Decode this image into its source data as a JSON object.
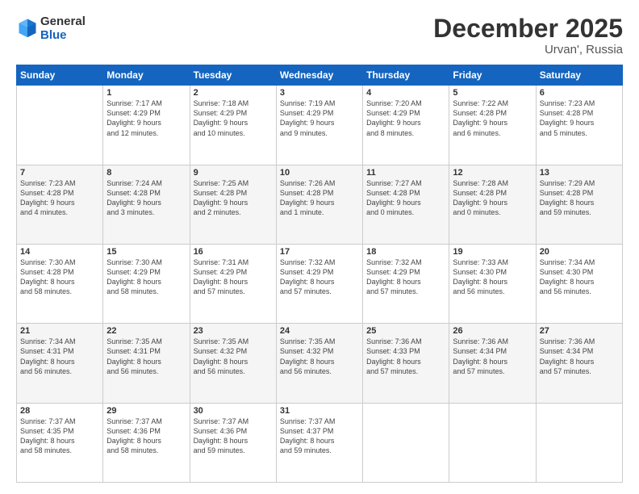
{
  "logo": {
    "line1": "General",
    "line2": "Blue"
  },
  "title": "December 2025",
  "subtitle": "Urvan', Russia",
  "days_of_week": [
    "Sunday",
    "Monday",
    "Tuesday",
    "Wednesday",
    "Thursday",
    "Friday",
    "Saturday"
  ],
  "weeks": [
    [
      {
        "day": "",
        "info": ""
      },
      {
        "day": "1",
        "info": "Sunrise: 7:17 AM\nSunset: 4:29 PM\nDaylight: 9 hours\nand 12 minutes."
      },
      {
        "day": "2",
        "info": "Sunrise: 7:18 AM\nSunset: 4:29 PM\nDaylight: 9 hours\nand 10 minutes."
      },
      {
        "day": "3",
        "info": "Sunrise: 7:19 AM\nSunset: 4:29 PM\nDaylight: 9 hours\nand 9 minutes."
      },
      {
        "day": "4",
        "info": "Sunrise: 7:20 AM\nSunset: 4:29 PM\nDaylight: 9 hours\nand 8 minutes."
      },
      {
        "day": "5",
        "info": "Sunrise: 7:22 AM\nSunset: 4:28 PM\nDaylight: 9 hours\nand 6 minutes."
      },
      {
        "day": "6",
        "info": "Sunrise: 7:23 AM\nSunset: 4:28 PM\nDaylight: 9 hours\nand 5 minutes."
      }
    ],
    [
      {
        "day": "7",
        "info": "Sunrise: 7:23 AM\nSunset: 4:28 PM\nDaylight: 9 hours\nand 4 minutes."
      },
      {
        "day": "8",
        "info": "Sunrise: 7:24 AM\nSunset: 4:28 PM\nDaylight: 9 hours\nand 3 minutes."
      },
      {
        "day": "9",
        "info": "Sunrise: 7:25 AM\nSunset: 4:28 PM\nDaylight: 9 hours\nand 2 minutes."
      },
      {
        "day": "10",
        "info": "Sunrise: 7:26 AM\nSunset: 4:28 PM\nDaylight: 9 hours\nand 1 minute."
      },
      {
        "day": "11",
        "info": "Sunrise: 7:27 AM\nSunset: 4:28 PM\nDaylight: 9 hours\nand 0 minutes."
      },
      {
        "day": "12",
        "info": "Sunrise: 7:28 AM\nSunset: 4:28 PM\nDaylight: 9 hours\nand 0 minutes."
      },
      {
        "day": "13",
        "info": "Sunrise: 7:29 AM\nSunset: 4:28 PM\nDaylight: 8 hours\nand 59 minutes."
      }
    ],
    [
      {
        "day": "14",
        "info": "Sunrise: 7:30 AM\nSunset: 4:28 PM\nDaylight: 8 hours\nand 58 minutes."
      },
      {
        "day": "15",
        "info": "Sunrise: 7:30 AM\nSunset: 4:29 PM\nDaylight: 8 hours\nand 58 minutes."
      },
      {
        "day": "16",
        "info": "Sunrise: 7:31 AM\nSunset: 4:29 PM\nDaylight: 8 hours\nand 57 minutes."
      },
      {
        "day": "17",
        "info": "Sunrise: 7:32 AM\nSunset: 4:29 PM\nDaylight: 8 hours\nand 57 minutes."
      },
      {
        "day": "18",
        "info": "Sunrise: 7:32 AM\nSunset: 4:29 PM\nDaylight: 8 hours\nand 57 minutes."
      },
      {
        "day": "19",
        "info": "Sunrise: 7:33 AM\nSunset: 4:30 PM\nDaylight: 8 hours\nand 56 minutes."
      },
      {
        "day": "20",
        "info": "Sunrise: 7:34 AM\nSunset: 4:30 PM\nDaylight: 8 hours\nand 56 minutes."
      }
    ],
    [
      {
        "day": "21",
        "info": "Sunrise: 7:34 AM\nSunset: 4:31 PM\nDaylight: 8 hours\nand 56 minutes."
      },
      {
        "day": "22",
        "info": "Sunrise: 7:35 AM\nSunset: 4:31 PM\nDaylight: 8 hours\nand 56 minutes."
      },
      {
        "day": "23",
        "info": "Sunrise: 7:35 AM\nSunset: 4:32 PM\nDaylight: 8 hours\nand 56 minutes."
      },
      {
        "day": "24",
        "info": "Sunrise: 7:35 AM\nSunset: 4:32 PM\nDaylight: 8 hours\nand 56 minutes."
      },
      {
        "day": "25",
        "info": "Sunrise: 7:36 AM\nSunset: 4:33 PM\nDaylight: 8 hours\nand 57 minutes."
      },
      {
        "day": "26",
        "info": "Sunrise: 7:36 AM\nSunset: 4:34 PM\nDaylight: 8 hours\nand 57 minutes."
      },
      {
        "day": "27",
        "info": "Sunrise: 7:36 AM\nSunset: 4:34 PM\nDaylight: 8 hours\nand 57 minutes."
      }
    ],
    [
      {
        "day": "28",
        "info": "Sunrise: 7:37 AM\nSunset: 4:35 PM\nDaylight: 8 hours\nand 58 minutes."
      },
      {
        "day": "29",
        "info": "Sunrise: 7:37 AM\nSunset: 4:36 PM\nDaylight: 8 hours\nand 58 minutes."
      },
      {
        "day": "30",
        "info": "Sunrise: 7:37 AM\nSunset: 4:36 PM\nDaylight: 8 hours\nand 59 minutes."
      },
      {
        "day": "31",
        "info": "Sunrise: 7:37 AM\nSunset: 4:37 PM\nDaylight: 8 hours\nand 59 minutes."
      },
      {
        "day": "",
        "info": ""
      },
      {
        "day": "",
        "info": ""
      },
      {
        "day": "",
        "info": ""
      }
    ]
  ]
}
